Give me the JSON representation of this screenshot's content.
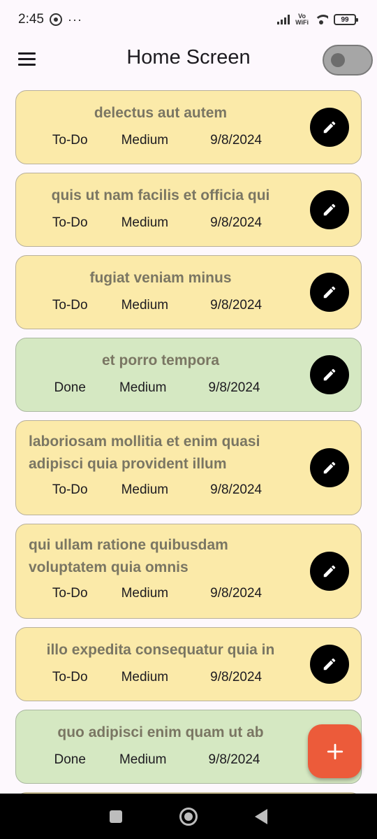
{
  "status_bar": {
    "time": "2:45",
    "overflow": "···",
    "vowifi_top": "Vo",
    "vowifi_bottom": "WiFi",
    "battery": "99",
    "icons": [
      "whatsapp-icon",
      "signal-icon",
      "wifi-icon",
      "battery-icon"
    ]
  },
  "app_bar": {
    "title": "Home Screen",
    "menu_icon": "hamburger-icon",
    "toggle_on": false
  },
  "tasks": [
    {
      "title": "delectus aut autem",
      "status": "To-Do",
      "priority": "Medium",
      "date": "9/8/2024"
    },
    {
      "title": "quis ut nam facilis et officia qui",
      "status": "To-Do",
      "priority": "Medium",
      "date": "9/8/2024"
    },
    {
      "title": "fugiat veniam minus",
      "status": "To-Do",
      "priority": "Medium",
      "date": "9/8/2024"
    },
    {
      "title": "et porro tempora",
      "status": "Done",
      "priority": "Medium",
      "date": "9/8/2024"
    },
    {
      "title": "laboriosam mollitia et enim quasi adipisci quia provident illum",
      "status": "To-Do",
      "priority": "Medium",
      "date": "9/8/2024"
    },
    {
      "title": "qui ullam ratione quibusdam voluptatem quia omnis",
      "status": "To-Do",
      "priority": "Medium",
      "date": "9/8/2024"
    },
    {
      "title": "illo expedita consequatur quia in",
      "status": "To-Do",
      "priority": "Medium",
      "date": "9/8/2024"
    },
    {
      "title": "quo adipisci enim quam ut ab",
      "status": "Done",
      "priority": "Medium",
      "date": "9/8/2024"
    }
  ],
  "colors": {
    "todo_card": "#fbeaa9",
    "done_card": "#d5e8c2",
    "fab": "#ec5b3a",
    "edit_button": "#000000"
  },
  "fab": {
    "icon": "plus-icon"
  },
  "nav_bar": {
    "icons": [
      "recent-apps-icon",
      "home-icon",
      "back-icon"
    ]
  }
}
